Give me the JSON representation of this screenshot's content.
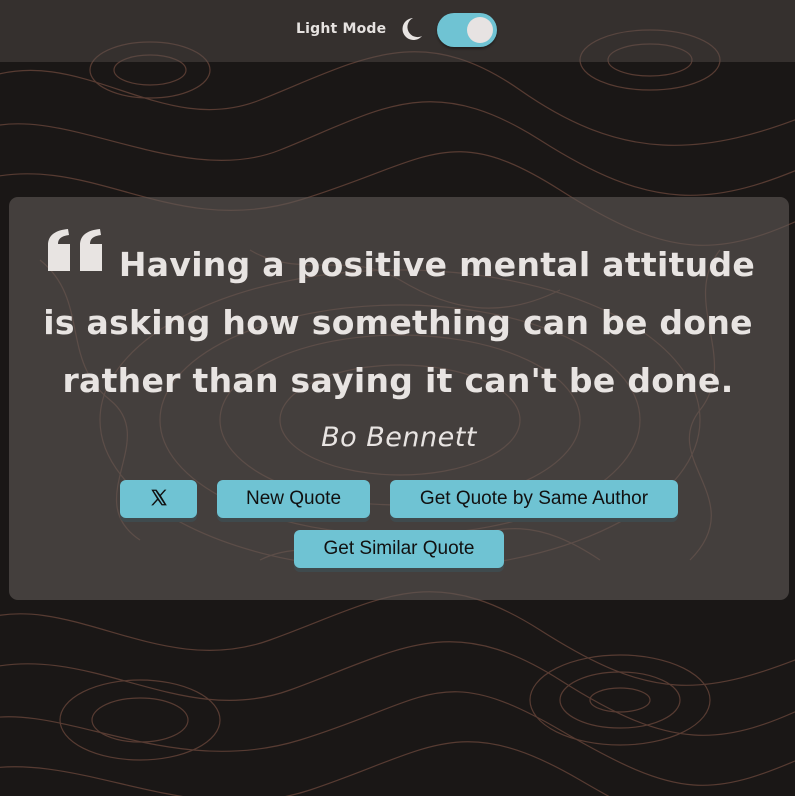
{
  "header": {
    "mode_label": "Light Mode",
    "mode_icon": "moon-icon",
    "toggle_on": true
  },
  "quote": {
    "icon": "quote-mark-icon",
    "text": "Having a positive mental attitude is asking how something can be done rather than saying it can't be done.",
    "author": "Bo Bennett"
  },
  "actions": {
    "share_icon": "x-logo-icon",
    "new_quote": "New Quote",
    "same_author": "Get Quote by Same Author",
    "similar": "Get Similar Quote"
  },
  "colors": {
    "accent": "#6fc3d3",
    "background": "#1a1716",
    "contour_lines": "#8a5a4a",
    "text": "#e8e4e2"
  }
}
